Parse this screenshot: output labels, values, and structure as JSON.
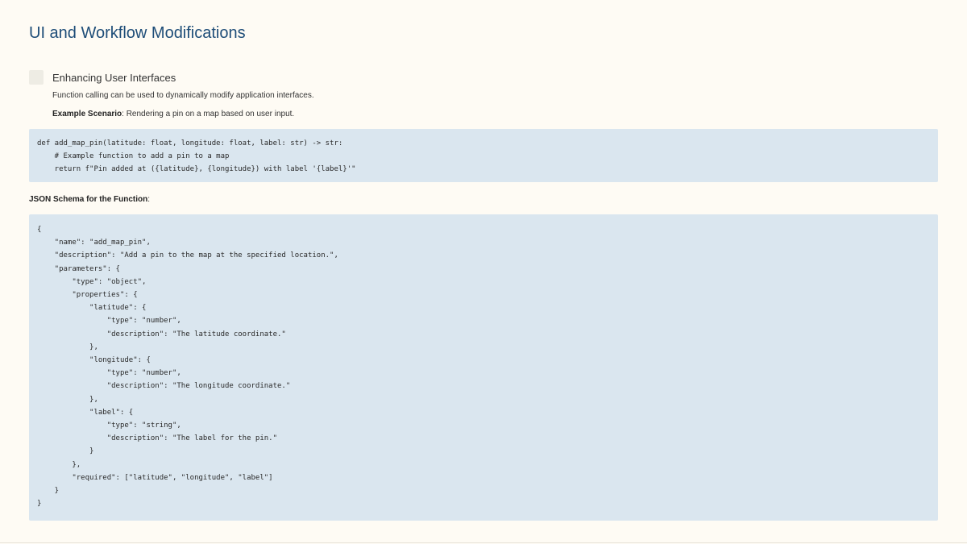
{
  "title": "UI and Workflow Modifications",
  "section": {
    "label": "Enhancing User Interfaces",
    "description": "Function calling can be used to dynamically modify application interfaces.",
    "scenario_label": "Example Scenario",
    "scenario_text": ": Rendering a pin on a map based on user input."
  },
  "code_function": "def add_map_pin(latitude: float, longitude: float, label: str) -> str:\n    # Example function to add a pin to a map\n    return f\"Pin added at ({latitude}, {longitude}) with label '{label}'\"",
  "schema": {
    "label": "JSON Schema for the Function",
    "suffix": ":"
  },
  "code_schema": "{\n    \"name\": \"add_map_pin\",\n    \"description\": \"Add a pin to the map at the specified location.\",\n    \"parameters\": {\n        \"type\": \"object\",\n        \"properties\": {\n            \"latitude\": {\n                \"type\": \"number\",\n                \"description\": \"The latitude coordinate.\"\n            },\n            \"longitude\": {\n                \"type\": \"number\",\n                \"description\": \"The longitude coordinate.\"\n            },\n            \"label\": {\n                \"type\": \"string\",\n                \"description\": \"The label for the pin.\"\n            }\n        },\n        \"required\": [\"latitude\", \"longitude\", \"label\"]\n    }\n}",
  "colors": {
    "background": "#fefbf4",
    "title": "#1e4d78",
    "code_background": "#dae6ef"
  }
}
